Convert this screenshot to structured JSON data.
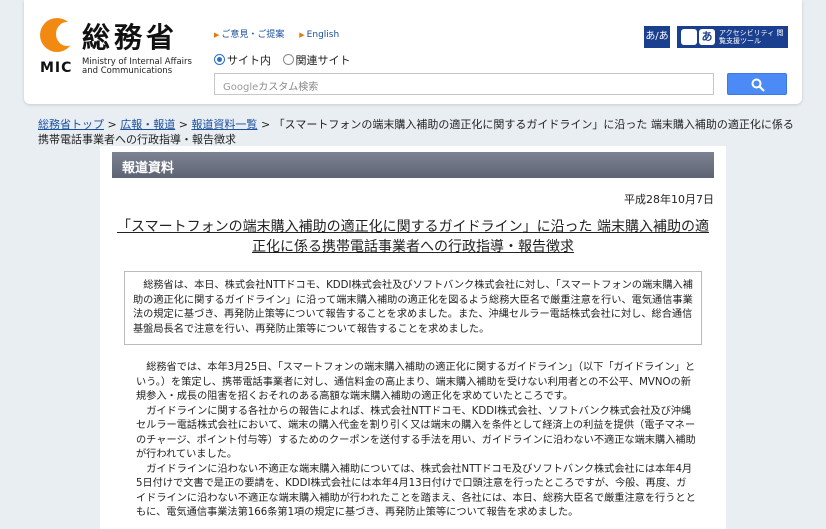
{
  "header": {
    "logo_kanji": "総務省",
    "logo_mic": "MIC",
    "logo_en": "Ministry of Internal Affairs and Communications",
    "links": [
      {
        "label": "ご意見・ご提案"
      },
      {
        "label": "English"
      }
    ],
    "radio_site": "サイト内",
    "radio_related": "関連サイト",
    "search_placeholder_brand": "Google",
    "search_placeholder": "カスタム検索",
    "hiragana_label": "あ/あ",
    "accessibility_label": "アクセシビリティ 閲覧支援ツール",
    "accent_color": "#1b3f8f"
  },
  "breadcrumb": {
    "item1": "総務省トップ",
    "item2": "広報・報道",
    "item3": "報道資料一覧",
    "current": "「スマートフォンの端末購入補助の適正化に関するガイドライン」に沿った 端末購入補助の適正化に係る携帯電話事業者への行政指導・報告徴求",
    "sep": ">"
  },
  "main": {
    "section_title": "報道資料",
    "date": "平成28年10月7日",
    "title": "「スマートフォンの端末購入補助の適正化に関するガイドライン」に沿った 端末購入補助の適正化に係る携帯電話事業者への行政指導・報告徴求",
    "summary": "総務省は、本日、株式会社NTTドコモ、KDDI株式会社及びソフトバンク株式会社に対し、「スマートフォンの端末購入補助の適正化に関するガイドライン」に沿って端末購入補助の適正化を図るよう総務大臣名で厳重注意を行い、電気通信事業法の規定に基づき、再発防止策等について報告することを求めました。また、沖縄セルラー電話株式会社に対し、総合通信基盤局長名で注意を行い、再発防止策等について報告することを求めました。",
    "para1": "総務省では、本年3月25日、「スマートフォンの端末購入補助の適正化に関するガイドライン」（以下「ガイドライン」という。）を策定し、携帯電話事業者に対し、通信料金の高止まり、端末購入補助を受けない利用者との不公平、MVNOの新規参入・成長の阻害を招くおそれのある高額な端末購入補助の適正化を求めていたところです。",
    "para2": "ガイドラインに関する各社からの報告によれば、株式会社NTTドコモ、KDDI株式会社、ソフトバンク株式会社及び沖縄セルラー電話株式会社において、端末の購入代金を割り引く又は端末の購入を条件として経済上の利益を提供（電子マネーのチャージ、ポイント付与等）するためのクーポンを送付する手法を用い、ガイドラインに沿わない不適正な端末購入補助が行われていました。",
    "para3": "ガイドラインに沿わない不適正な端末購入補助については、株式会社NTTドコモ及びソフトバンク株式会社には本年4月5日付けで文書で是正の要請を、KDDI株式会社には本年4月13日付けで口頭注意を行ったところですが、今般、再度、ガイドラインに沿わない不適正な端末購入補助が行われたことを踏まえ、各社には、本日、総務大臣名で厳重注意を行うとともに、電気通信事業法第166条第1項の規定に基づき、再発防止策等について報告を求めました。"
  }
}
